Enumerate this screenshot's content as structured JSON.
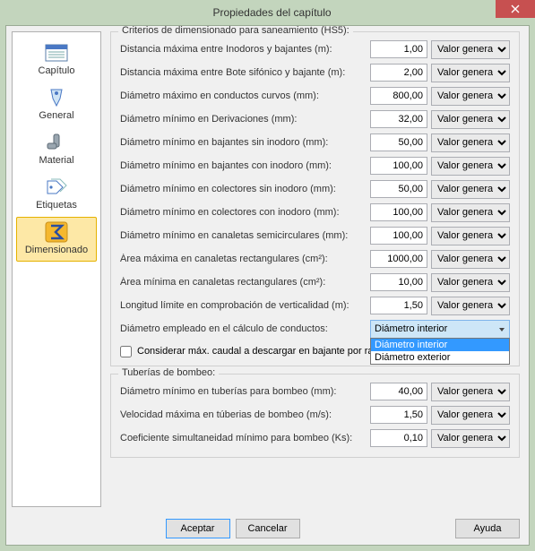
{
  "window": {
    "title": "Propiedades del capítulo"
  },
  "sidebar": {
    "items": [
      {
        "label": "Capítulo"
      },
      {
        "label": "General"
      },
      {
        "label": "Material"
      },
      {
        "label": "Etiquetas"
      },
      {
        "label": "Dimensionado"
      }
    ]
  },
  "group1": {
    "legend": "Criterios de dimensionado para saneamiento (HS5):",
    "rows": [
      {
        "label": "Distancia máxima entre Inodoros y bajantes (m):",
        "value": "1,00",
        "combo": "Valor general"
      },
      {
        "label": "Distancia máxima entre Bote sifónico y bajante (m):",
        "value": "2,00",
        "combo": "Valor general"
      },
      {
        "label": "Diámetro máximo en conductos curvos (mm):",
        "value": "800,00",
        "combo": "Valor general"
      },
      {
        "label": "Diámetro mínimo en Derivaciones (mm):",
        "value": "32,00",
        "combo": "Valor general"
      },
      {
        "label": "Diámetro mínimo en bajantes sin inodoro (mm):",
        "value": "50,00",
        "combo": "Valor general"
      },
      {
        "label": "Diámetro mínimo en bajantes con inodoro (mm):",
        "value": "100,00",
        "combo": "Valor general"
      },
      {
        "label": "Diámetro mínimo en colectores sin inodoro (mm):",
        "value": "50,00",
        "combo": "Valor general"
      },
      {
        "label": "Diámetro mínimo en colectores con inodoro (mm):",
        "value": "100,00",
        "combo": "Valor general"
      },
      {
        "label": "Diámetro mínimo en canaletas semicirculares (mm):",
        "value": "100,00",
        "combo": "Valor general"
      },
      {
        "label": "Área máxima en canaletas rectangulares (cm²):",
        "value": "1000,00",
        "combo": "Valor general"
      },
      {
        "label": "Área mínima en canaletas rectangulares (cm²):",
        "value": "10,00",
        "combo": "Valor general"
      },
      {
        "label": "Longitud límite en comprobación de verticalidad (m):",
        "value": "1,50",
        "combo": "Valor general"
      }
    ],
    "diam_row": {
      "label": "Diámetro empleado en el cálculo de conductos:",
      "selected": "Diámetro interior",
      "options": [
        "Diámetro interior",
        "Diámetro exterior"
      ]
    },
    "checkbox": "Considerar máx. caudal a descargar en bajante por ramal"
  },
  "group2": {
    "legend": "Tuberías de bombeo:",
    "rows": [
      {
        "label": "Diámetro mínimo en tuberías para bombeo (mm):",
        "value": "40,00",
        "combo": "Valor general"
      },
      {
        "label": "Velocidad máxima en túberias de bombeo (m/s):",
        "value": "1,50",
        "combo": "Valor general"
      },
      {
        "label": "Coeficiente simultaneidad mínimo para bombeo (Ks):",
        "value": "0,10",
        "combo": "Valor general"
      }
    ]
  },
  "buttons": {
    "ok": "Aceptar",
    "cancel": "Cancelar",
    "help": "Ayuda"
  }
}
